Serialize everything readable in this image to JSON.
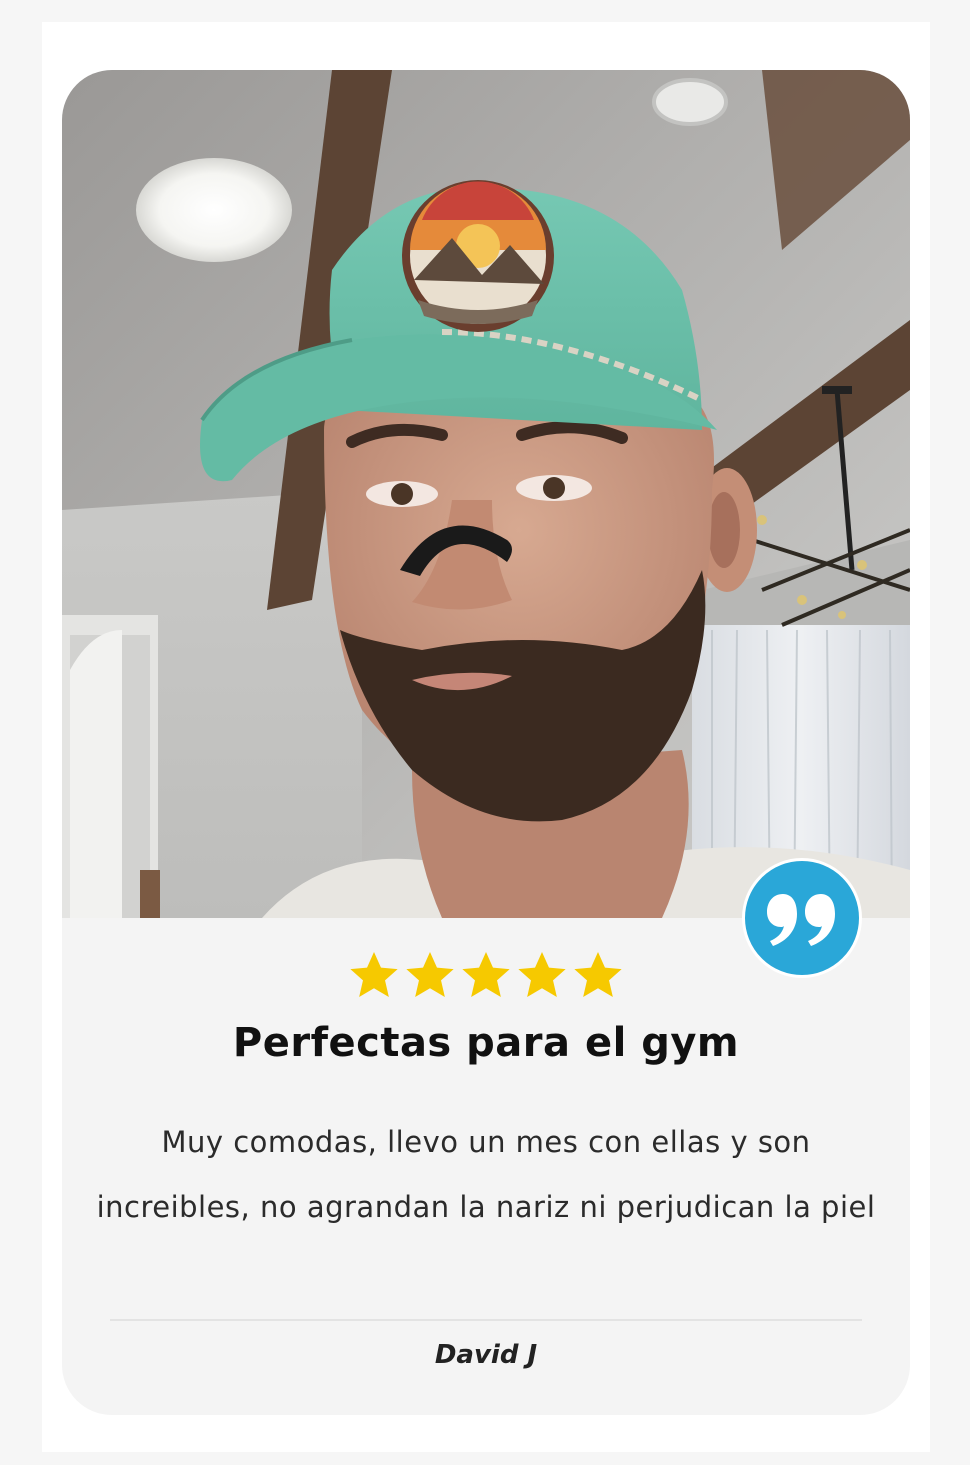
{
  "review": {
    "photo_description_icon": "reviewer-selfie",
    "quote_icon": "quote-icon",
    "rating": 5,
    "max_rating": 5,
    "star_color": "#f6c900",
    "badge_color": "#2aa7d8",
    "title": "Perfectas para el gym",
    "body": "Muy comodas, llevo un mes con ellas y son increibles, no agrandan la nariz ni perjudican la piel",
    "author": "David J"
  }
}
